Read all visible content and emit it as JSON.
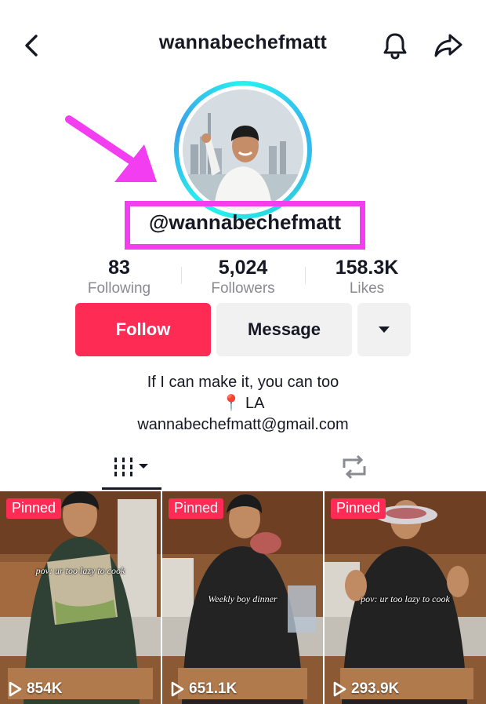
{
  "header": {
    "title": "wannabechefmatt",
    "back_icon": "chevron-left-icon",
    "bell_icon": "bell-icon",
    "share_icon": "share-icon"
  },
  "profile": {
    "username": "@wannabechefmatt",
    "annotation_color": "#f23ef0"
  },
  "stats": [
    {
      "value": "83",
      "label": "Following"
    },
    {
      "value": "5,024",
      "label": "Followers"
    },
    {
      "value": "158.3K",
      "label": "Likes"
    }
  ],
  "actions": {
    "follow_label": "Follow",
    "message_label": "Message",
    "more_icon": "caret-down-icon",
    "follow_color": "#fe2c55"
  },
  "bio": {
    "line1": "If I can make it, you can too",
    "location_icon": "📍",
    "location": "LA",
    "email": "wannabechefmatt@gmail.com"
  },
  "tabs": {
    "videos_icon": "grid-lines-icon",
    "reposts_icon": "repost-icon"
  },
  "videos": [
    {
      "badge": "Pinned",
      "caption": "pov: ur too lazy to cook",
      "views": "854K"
    },
    {
      "badge": "Pinned",
      "caption": "Weekly boy dinner",
      "views": "651.1K"
    },
    {
      "badge": "Pinned",
      "caption": "pov: ur too lazy to cook",
      "views": "293.9K"
    }
  ]
}
